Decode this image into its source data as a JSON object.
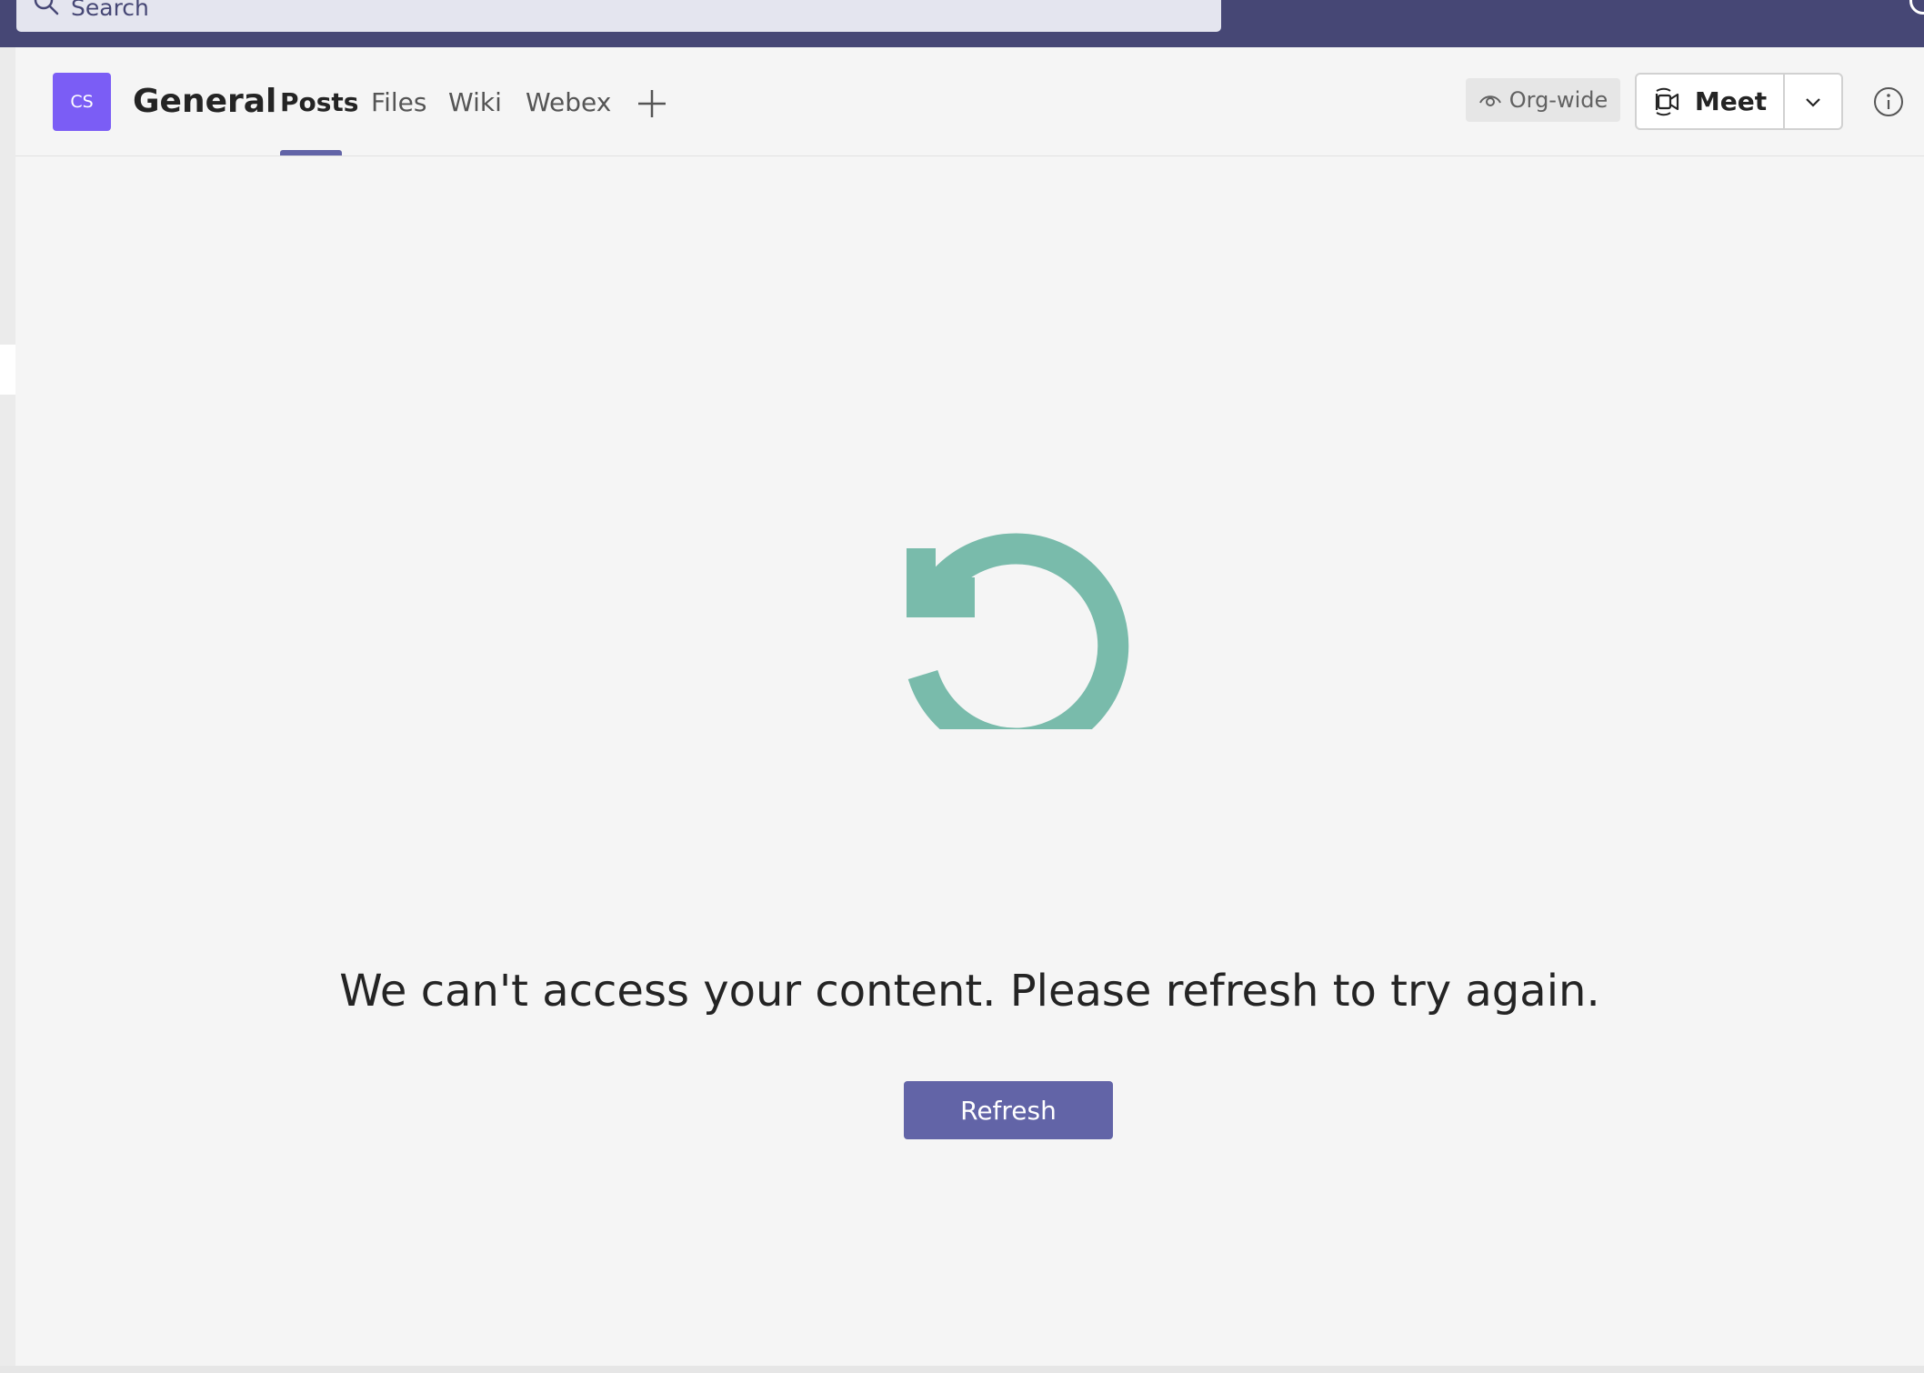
{
  "search": {
    "placeholder": "Search"
  },
  "channel": {
    "team_initials": "CS",
    "title": "General"
  },
  "tabs": [
    {
      "label": "Posts",
      "active": true
    },
    {
      "label": "Files",
      "active": false
    },
    {
      "label": "Wiki",
      "active": false
    },
    {
      "label": "Webex",
      "active": false
    }
  ],
  "header_actions": {
    "org_label": "Org-wide",
    "meet_label": "Meet",
    "icons": [
      "eye-icon",
      "video-camera-icon",
      "chevron-down-icon",
      "info-icon",
      "add-icon"
    ]
  },
  "error_state": {
    "icon": "refresh-icon",
    "message": "We can't access your content. Please refresh to try again.",
    "button_label": "Refresh"
  },
  "colors": {
    "topbar": "#464775",
    "accent": "#6264a7",
    "avatar": "#7b5df5",
    "refresh_icon": "#79bbab",
    "background": "#f5f5f5"
  }
}
